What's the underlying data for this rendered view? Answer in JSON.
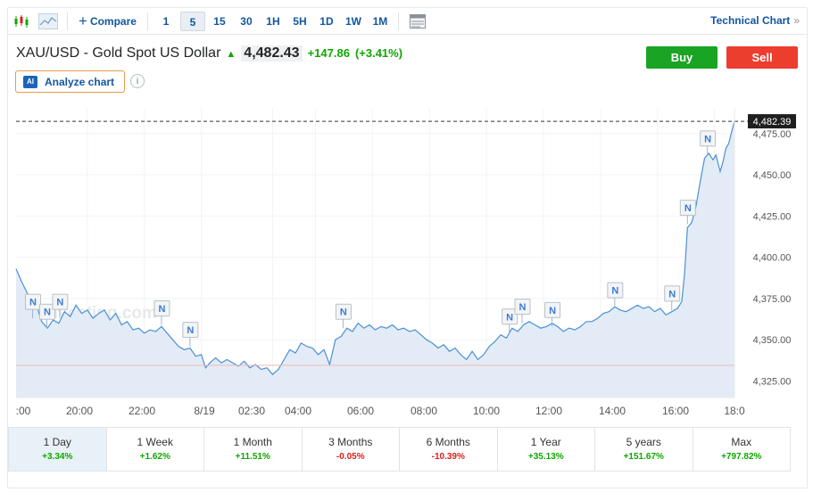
{
  "toolbar": {
    "compare_label": "Compare",
    "intervals": [
      "1",
      "5",
      "15",
      "30",
      "1H",
      "5H",
      "1D",
      "1W",
      "1M"
    ],
    "active_interval": "5",
    "technical_label": "Technical Chart",
    "technical_chevron": "»"
  },
  "header": {
    "symbol": "XAU/USD - Gold Spot US Dollar",
    "price": "4,482.43",
    "change": "+147.86",
    "change_pct": "(+3.41%)",
    "buy_label": "Buy",
    "sell_label": "Sell",
    "analyze_label": "Analyze chart",
    "ai_badge": "AI",
    "info_glyph": "i"
  },
  "colors": {
    "up": "#0ea600",
    "down": "#d91e18",
    "line": "#4a90d6",
    "fill": "#e3ecf6",
    "link": "#1256a0"
  },
  "chart_data": {
    "type": "area",
    "watermark": "Investing.com",
    "last_price_label": "4,482.39",
    "last_price": 4482.39,
    "reference_price": 4334.5,
    "x_tick_labels": [
      ":00",
      "20:00",
      "22:00",
      "8/19",
      "02:30",
      "04:00",
      "06:00",
      "08:00",
      "10:00",
      "12:00",
      "14:00",
      "16:00",
      "18:0"
    ],
    "y_tick_labels": [
      "4,325.00",
      "4,350.00",
      "4,375.00",
      "4,400.00",
      "4,425.00",
      "4,450.00",
      "4,475.00"
    ],
    "y_ticks": [
      4325,
      4350,
      4375,
      4400,
      4425,
      4450,
      4475
    ],
    "ylim": [
      4315,
      4490
    ],
    "x_range_hours": [
      17.5,
      42.7
    ],
    "series": [
      {
        "points": [
          [
            17.5,
            4393
          ],
          [
            17.7,
            4385
          ],
          [
            17.9,
            4378
          ],
          [
            18.05,
            4372
          ],
          [
            18.25,
            4369
          ],
          [
            18.4,
            4361
          ],
          [
            18.6,
            4357
          ],
          [
            18.8,
            4362
          ],
          [
            19.0,
            4360
          ],
          [
            19.2,
            4367
          ],
          [
            19.4,
            4364
          ],
          [
            19.6,
            4371
          ],
          [
            19.8,
            4366
          ],
          [
            20.0,
            4368
          ],
          [
            20.2,
            4363
          ],
          [
            20.4,
            4366
          ],
          [
            20.6,
            4368
          ],
          [
            20.8,
            4362
          ],
          [
            21.0,
            4366
          ],
          [
            21.2,
            4359
          ],
          [
            21.4,
            4361
          ],
          [
            21.6,
            4356
          ],
          [
            21.8,
            4357
          ],
          [
            22.0,
            4354
          ],
          [
            22.2,
            4356
          ],
          [
            22.4,
            4355
          ],
          [
            22.6,
            4358
          ],
          [
            22.8,
            4354
          ],
          [
            23.0,
            4350
          ],
          [
            23.2,
            4346
          ],
          [
            23.4,
            4344
          ],
          [
            23.6,
            4345
          ],
          [
            23.8,
            4340
          ],
          [
            24.0,
            4341
          ],
          [
            24.15,
            4333
          ],
          [
            24.3,
            4336
          ],
          [
            24.5,
            4339
          ],
          [
            24.7,
            4336
          ],
          [
            24.9,
            4338
          ],
          [
            25.1,
            4336
          ],
          [
            25.3,
            4334
          ],
          [
            25.5,
            4337
          ],
          [
            25.7,
            4333
          ],
          [
            25.9,
            4335
          ],
          [
            26.1,
            4332
          ],
          [
            26.3,
            4333
          ],
          [
            26.5,
            4329
          ],
          [
            26.7,
            4332
          ],
          [
            26.9,
            4338
          ],
          [
            27.1,
            4344
          ],
          [
            27.3,
            4342
          ],
          [
            27.5,
            4348
          ],
          [
            27.7,
            4346
          ],
          [
            27.9,
            4345
          ],
          [
            28.1,
            4341
          ],
          [
            28.3,
            4344
          ],
          [
            28.5,
            4335
          ],
          [
            28.7,
            4350
          ],
          [
            28.9,
            4352
          ],
          [
            29.1,
            4357
          ],
          [
            29.3,
            4355
          ],
          [
            29.5,
            4360
          ],
          [
            29.7,
            4357
          ],
          [
            29.9,
            4359
          ],
          [
            30.1,
            4356
          ],
          [
            30.3,
            4358
          ],
          [
            30.5,
            4357
          ],
          [
            30.7,
            4359
          ],
          [
            30.9,
            4356
          ],
          [
            31.1,
            4357
          ],
          [
            31.3,
            4355
          ],
          [
            31.5,
            4356
          ],
          [
            31.7,
            4353
          ],
          [
            31.9,
            4350
          ],
          [
            32.1,
            4348
          ],
          [
            32.3,
            4345
          ],
          [
            32.5,
            4347
          ],
          [
            32.7,
            4343
          ],
          [
            32.9,
            4345
          ],
          [
            33.1,
            4341
          ],
          [
            33.3,
            4338
          ],
          [
            33.5,
            4343
          ],
          [
            33.7,
            4338
          ],
          [
            33.9,
            4341
          ],
          [
            34.1,
            4346
          ],
          [
            34.3,
            4349
          ],
          [
            34.5,
            4353
          ],
          [
            34.7,
            4351
          ],
          [
            34.9,
            4357
          ],
          [
            35.1,
            4355
          ],
          [
            35.3,
            4359
          ],
          [
            35.5,
            4361
          ],
          [
            35.7,
            4359
          ],
          [
            35.9,
            4357
          ],
          [
            36.1,
            4358
          ],
          [
            36.3,
            4360
          ],
          [
            36.5,
            4358
          ],
          [
            36.7,
            4355
          ],
          [
            36.9,
            4357
          ],
          [
            37.1,
            4356
          ],
          [
            37.3,
            4358
          ],
          [
            37.5,
            4361
          ],
          [
            37.7,
            4361
          ],
          [
            37.9,
            4363
          ],
          [
            38.1,
            4366
          ],
          [
            38.3,
            4367
          ],
          [
            38.5,
            4370
          ],
          [
            38.7,
            4368
          ],
          [
            38.9,
            4367
          ],
          [
            39.1,
            4369
          ],
          [
            39.3,
            4371
          ],
          [
            39.5,
            4369
          ],
          [
            39.7,
            4370
          ],
          [
            39.9,
            4367
          ],
          [
            40.1,
            4369
          ],
          [
            40.3,
            4365
          ],
          [
            40.5,
            4367
          ],
          [
            40.7,
            4369
          ],
          [
            40.85,
            4373
          ],
          [
            40.95,
            4390
          ],
          [
            41.05,
            4418
          ],
          [
            41.2,
            4421
          ],
          [
            41.35,
            4431
          ],
          [
            41.5,
            4446
          ],
          [
            41.65,
            4460
          ],
          [
            41.8,
            4463
          ],
          [
            41.95,
            4459
          ],
          [
            42.05,
            4462
          ],
          [
            42.2,
            4452
          ],
          [
            42.3,
            4458
          ],
          [
            42.4,
            4466
          ],
          [
            42.5,
            4469
          ],
          [
            42.6,
            4476
          ],
          [
            42.7,
            4482.39
          ]
        ]
      }
    ],
    "news_markers": [
      {
        "label": "N",
        "x": 18.08,
        "y": 4363
      },
      {
        "label": "N",
        "x": 18.58,
        "y": 4357
      },
      {
        "label": "N",
        "x": 19.03,
        "y": 4363
      },
      {
        "label": "N",
        "x": 22.6,
        "y": 4359
      },
      {
        "label": "N",
        "x": 23.6,
        "y": 4346
      },
      {
        "label": "N",
        "x": 28.97,
        "y": 4357
      },
      {
        "label": "N",
        "x": 34.8,
        "y": 4354
      },
      {
        "label": "N",
        "x": 35.25,
        "y": 4360
      },
      {
        "label": "N",
        "x": 36.3,
        "y": 4358
      },
      {
        "label": "N",
        "x": 38.5,
        "y": 4370
      },
      {
        "label": "N",
        "x": 40.5,
        "y": 4368
      },
      {
        "label": "N",
        "x": 41.05,
        "y": 4420
      },
      {
        "label": "N",
        "x": 41.75,
        "y": 4462
      }
    ]
  },
  "ranges": [
    {
      "label": "1 Day",
      "value": "+3.34%",
      "dir": "pos",
      "active": true
    },
    {
      "label": "1 Week",
      "value": "+1.62%",
      "dir": "pos",
      "active": false
    },
    {
      "label": "1 Month",
      "value": "+11.51%",
      "dir": "pos",
      "active": false
    },
    {
      "label": "3 Months",
      "value": "-0.05%",
      "dir": "neg",
      "active": false
    },
    {
      "label": "6 Months",
      "value": "-10.39%",
      "dir": "neg",
      "active": false
    },
    {
      "label": "1 Year",
      "value": "+35.13%",
      "dir": "pos",
      "active": false
    },
    {
      "label": "5 years",
      "value": "+151.67%",
      "dir": "pos",
      "active": false
    },
    {
      "label": "Max",
      "value": "+797.82%",
      "dir": "pos",
      "active": false
    }
  ]
}
